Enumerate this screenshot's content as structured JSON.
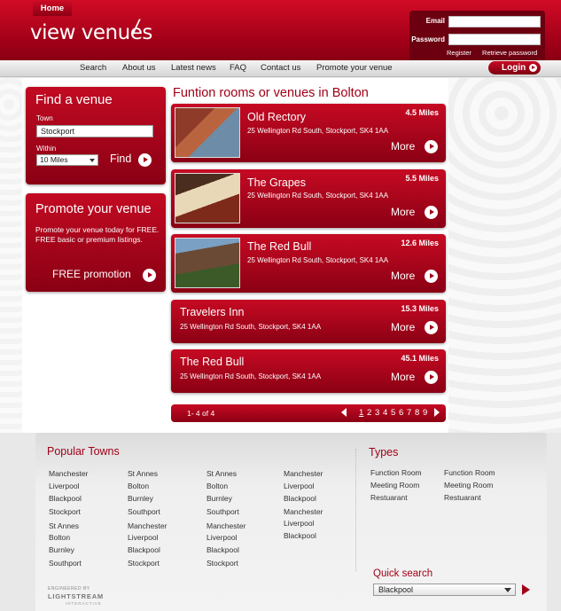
{
  "header": {
    "logo": "view venues",
    "login": {
      "email_label": "Email",
      "password_label": "Password",
      "register": "Register",
      "retrieve": "Retrieve password"
    }
  },
  "nav": {
    "items": [
      "Home",
      "Search",
      "About us",
      "Latest news",
      "FAQ",
      "Contact us",
      "Promote your venue"
    ],
    "login_button": "Login"
  },
  "find": {
    "title": "Find a venue",
    "town_label": "Town",
    "town_value": "Stockport",
    "within_label": "Within",
    "within_value": "10 Miles",
    "find_button": "Find"
  },
  "promote": {
    "title": "Promote your venue",
    "text": "Promote your venue today for FREE. FREE basic or premium listings.",
    "button": "FREE promotion"
  },
  "main": {
    "title": "Funtion rooms or venues in Bolton",
    "venues": [
      {
        "name": "Old Rectory",
        "address": "25 Wellington Rd South, Stockport, SK4 1AA",
        "miles": "4.5 Miles",
        "more": "More"
      },
      {
        "name": "The Grapes",
        "address": "25 Wellington Rd South, Stockport, SK4 1AA",
        "miles": "5.5 Miles",
        "more": "More"
      },
      {
        "name": "The Red Bull",
        "address": "25 Wellington Rd South, Stockport, SK4 1AA",
        "miles": "12.6 Miles",
        "more": "More"
      },
      {
        "name": "Travelers Inn",
        "address": "25 Wellington Rd South, Stockport, SK4 1AA",
        "miles": "15.3 Miles",
        "more": "More"
      },
      {
        "name": "The Red Bull",
        "address": "25 Wellington Rd South, Stockport, SK4 1AA",
        "miles": "45.1 Miles",
        "more": "More"
      }
    ],
    "pager": {
      "info": "1- 4 of 4",
      "pages": [
        "1",
        "2",
        "3",
        "4",
        "5",
        "6",
        "7",
        "8",
        "9"
      ]
    }
  },
  "footer": {
    "popular_title": "Popular Towns",
    "towns": [
      [
        "Manchester",
        "Liverpool",
        "Blackpool",
        "Stockport",
        "St Annes",
        "Bolton",
        "Burnley",
        "Southport"
      ],
      [
        "St Annes",
        "Bolton",
        "Burnley",
        "Southport",
        "Manchester",
        "Liverpool",
        "Blackpool",
        "Stockport"
      ],
      [
        "St Annes",
        "Bolton",
        "Burnley",
        "Southport",
        "Manchester",
        "Liverpool",
        "Blackpool",
        "Stockport"
      ],
      [
        "Manchester",
        "Liverpool",
        "Blackpool",
        "Manchester",
        "Liverpool",
        "Blackpool"
      ]
    ],
    "types_title": "Types",
    "types": [
      [
        "Function Room",
        "Meeting Room",
        "Restuarant"
      ],
      [
        "Function Room",
        "Meeting Room",
        "Restuarant"
      ]
    ],
    "quick_search_title": "Quick search",
    "quick_search_value": "Blackpool",
    "engineered": "ENGINEERED BY",
    "brand": "LIGHTSTREAM",
    "brand_sub": "INTERACTIVE"
  },
  "colors": {
    "brand_red": "#a00018",
    "brand_red_light": "#c60a23"
  }
}
